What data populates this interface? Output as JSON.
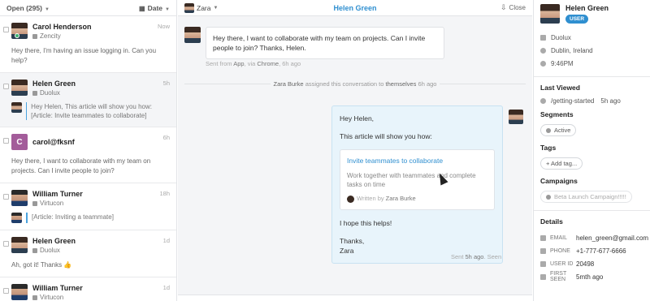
{
  "inbox": {
    "filter_label": "Open (295)",
    "sort_label": "Date",
    "conversations": [
      {
        "name": "Carol Henderson",
        "company": "Zencity",
        "time": "Now",
        "preview": "Hey there, I'm having an issue logging in. Can you help?"
      },
      {
        "name": "Helen Green",
        "company": "Duolux",
        "time": "5h",
        "quote": "Hey Helen, This article will show you how: [Article: Invite teammates to collaborate]"
      },
      {
        "name": "carol@fksnf",
        "initial": "C",
        "time": "6h",
        "preview": "Hey there, I want to collaborate with my team on projects. Can I invite people to join?"
      },
      {
        "name": "William Turner",
        "company": "Virtucon",
        "time": "18h",
        "quote": "[Article: Inviting a teammate]"
      },
      {
        "name": "Helen Green",
        "company": "Duolux",
        "time": "1d",
        "preview": "Ah, got it! Thanks 👍"
      },
      {
        "name": "William Turner",
        "company": "Virtucon",
        "time": "1d"
      }
    ]
  },
  "conversation": {
    "assignee": "Zara",
    "title": "Helen Green",
    "close_label": "Close",
    "incoming_message": "Hey there, I want to collaborate with my team on projects. Can I invite people to join? Thanks, Helen.",
    "incoming_meta": {
      "prefix": "Sent from ",
      "app": "App",
      "via": ", via ",
      "browser": "Chrome",
      "time": ", 6h ago"
    },
    "assignment": {
      "actor": "Zara Burke",
      "action": " assigned this conversation to ",
      "target": "themselves",
      "time": " 6h ago"
    },
    "reply": {
      "greeting": "Hey Helen,",
      "intro": "This article will show you how:",
      "article_title": "Invite teammates to collaborate",
      "article_desc": "Work together with teammates and complete tasks on time",
      "article_author_prefix": "Written by",
      "article_author": "Zara Burke",
      "closing": "I hope this helps!",
      "signoff": "Thanks,",
      "signature": "Zara"
    },
    "reply_meta": {
      "prefix": "Sent ",
      "time": "5h ago",
      "status": ". Seen"
    }
  },
  "profile": {
    "name": "Helen Green",
    "role_badge": "USER",
    "company": "Duolux",
    "location": "Dublin, Ireland",
    "local_time": "9:46PM",
    "last_viewed_heading": "Last Viewed",
    "last_viewed_page": "/getting-started",
    "last_viewed_time": "5h ago",
    "segments_heading": "Segments",
    "segment": "Active",
    "tags_heading": "Tags",
    "add_tag_label": "+ Add tag...",
    "campaigns_heading": "Campaigns",
    "campaign": "Beta Launch Campaign!!!!!",
    "details_heading": "Details",
    "details": [
      {
        "label": "EMAIL",
        "value": "helen_green@gmail.com"
      },
      {
        "label": "PHONE",
        "value": "+1-777-677-6666"
      },
      {
        "label": "USER ID",
        "value": "20498"
      },
      {
        "label": "FIRST SEEN",
        "value": "5mth ago"
      }
    ]
  },
  "colors": {
    "accent": "#2f8fd0",
    "online": "#3cb371",
    "reply_bg": "#e8f4fb"
  }
}
